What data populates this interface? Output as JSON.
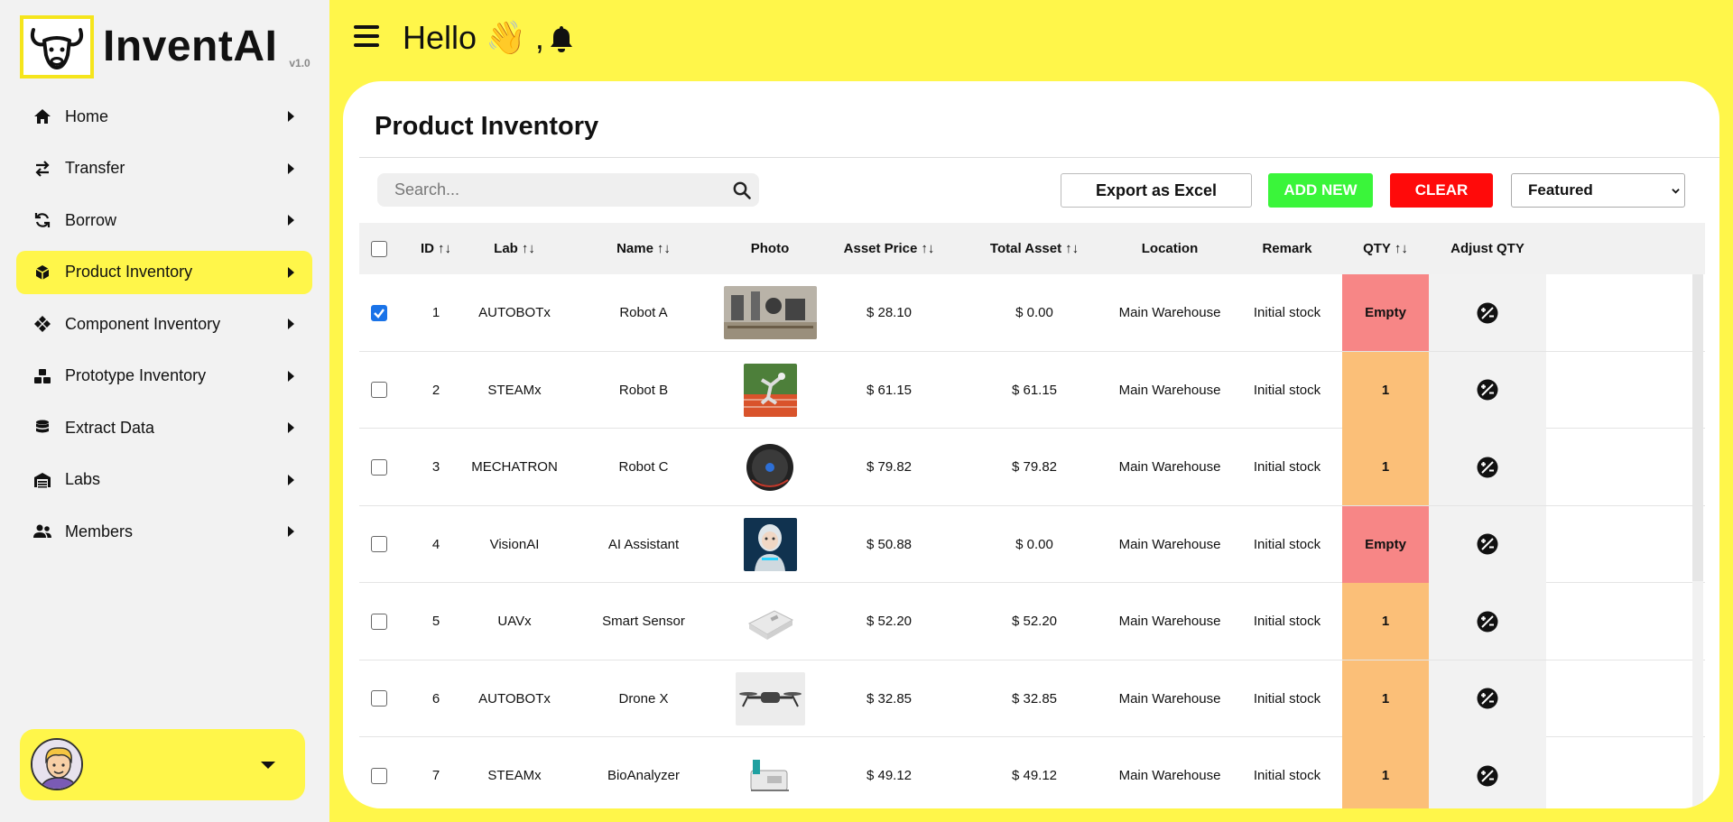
{
  "brand": {
    "name": "InventAI",
    "version": "v1.0"
  },
  "sidebar": {
    "items": [
      {
        "label": "Home",
        "icon": "home-icon"
      },
      {
        "label": "Transfer",
        "icon": "transfer-icon"
      },
      {
        "label": "Borrow",
        "icon": "borrow-icon"
      },
      {
        "label": "Product Inventory",
        "icon": "product-icon",
        "active": true
      },
      {
        "label": "Component Inventory",
        "icon": "component-icon"
      },
      {
        "label": "Prototype Inventory",
        "icon": "prototype-icon"
      },
      {
        "label": "Extract Data",
        "icon": "database-icon"
      },
      {
        "label": "Labs",
        "icon": "labs-icon"
      },
      {
        "label": "Members",
        "icon": "members-icon"
      }
    ]
  },
  "header": {
    "greeting": "Hello 👋 ,"
  },
  "page": {
    "title": "Product Inventory"
  },
  "toolbar": {
    "search_placeholder": "Search...",
    "export_label": "Export as Excel",
    "add_label": "ADD NEW",
    "clear_label": "CLEAR",
    "sort_selected": "Featured"
  },
  "table": {
    "headers": {
      "id": "ID",
      "lab": "Lab",
      "name": "Name",
      "photo": "Photo",
      "asset_price": "Asset Price",
      "total_asset": "Total Asset",
      "location": "Location",
      "remark": "Remark",
      "qty": "QTY",
      "adjust": "Adjust QTY"
    },
    "sort_arrows": "↑↓",
    "rows": [
      {
        "checked": true,
        "id": "1",
        "lab": "AUTOBOTx",
        "name": "Robot A",
        "price": "$ 28.10",
        "total": "$ 0.00",
        "location": "Main Warehouse",
        "remark": "Initial stock",
        "qty": "Empty"
      },
      {
        "checked": false,
        "id": "2",
        "lab": "STEAMx",
        "name": "Robot B",
        "price": "$ 61.15",
        "total": "$ 61.15",
        "location": "Main Warehouse",
        "remark": "Initial stock",
        "qty": "1"
      },
      {
        "checked": false,
        "id": "3",
        "lab": "MECHATRON",
        "name": "Robot C",
        "price": "$ 79.82",
        "total": "$ 79.82",
        "location": "Main Warehouse",
        "remark": "Initial stock",
        "qty": "1"
      },
      {
        "checked": false,
        "id": "4",
        "lab": "VisionAI",
        "name": "AI Assistant",
        "price": "$ 50.88",
        "total": "$ 0.00",
        "location": "Main Warehouse",
        "remark": "Initial stock",
        "qty": "Empty"
      },
      {
        "checked": false,
        "id": "5",
        "lab": "UAVx",
        "name": "Smart Sensor",
        "price": "$ 52.20",
        "total": "$ 52.20",
        "location": "Main Warehouse",
        "remark": "Initial stock",
        "qty": "1"
      },
      {
        "checked": false,
        "id": "6",
        "lab": "AUTOBOTx",
        "name": "Drone X",
        "price": "$ 32.85",
        "total": "$ 32.85",
        "location": "Main Warehouse",
        "remark": "Initial stock",
        "qty": "1"
      },
      {
        "checked": false,
        "id": "7",
        "lab": "STEAMx",
        "name": "BioAnalyzer",
        "price": "$ 49.12",
        "total": "$ 49.12",
        "location": "Main Warehouse",
        "remark": "Initial stock",
        "qty": "1"
      }
    ]
  },
  "colors": {
    "accent_yellow": "#fff64a",
    "qty_empty": "#f78686",
    "qty_stock": "#fbbf78",
    "add_green": "#3af53a",
    "clear_red": "#ff0a0a"
  }
}
